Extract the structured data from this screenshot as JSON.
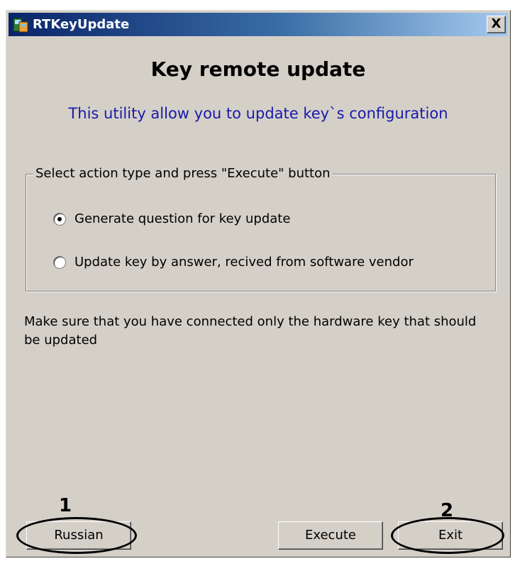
{
  "window": {
    "title": "RTKeyUpdate",
    "close_label": "X"
  },
  "main": {
    "heading": "Key remote update",
    "subtitle": "This utility allow you to update key`s configuration",
    "group": {
      "legend": "Select action type and press \"Execute\" button",
      "options": [
        {
          "label": "Generate question for key update",
          "checked": true
        },
        {
          "label": "Update key by answer, recived from software vendor",
          "checked": false
        }
      ]
    },
    "note": "Make sure that you have connected only the hardware key that should be updated"
  },
  "buttons": {
    "russian": "Russian",
    "execute": "Execute",
    "exit": "Exit"
  },
  "annotations": {
    "marker1": "1",
    "marker2": "2"
  },
  "colors": {
    "subtitle": "#1a1aa8",
    "title_bar": "#0a246a",
    "window_bg": "#d4d0c8"
  }
}
